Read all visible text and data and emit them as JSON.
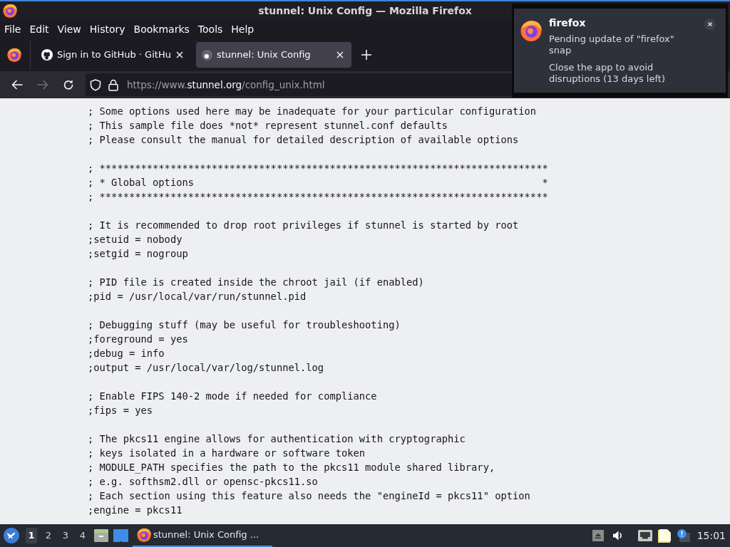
{
  "window": {
    "title": "stunnel: Unix Config — Mozilla Firefox"
  },
  "menu": [
    "File",
    "Edit",
    "View",
    "History",
    "Bookmarks",
    "Tools",
    "Help"
  ],
  "tabs": [
    {
      "title": "Sign in to GitHub · GitHu",
      "selected": false
    },
    {
      "title": "stunnel: Unix Config",
      "selected": true
    }
  ],
  "toolbar": {
    "forward_disabled": true,
    "url": {
      "prefix": "https://www.",
      "domain": "stunnel.org",
      "path": "/config_unix.html"
    }
  },
  "page": {
    "blocks": [
      [
        "; Some options used here may be inadequate for your particular configuration",
        "; This sample file does *not* represent stunnel.conf defaults",
        "; Please consult the manual for detailed description of available options"
      ],
      [
        "; ****************************************************************************",
        "; * Global options                                                           *",
        "; ****************************************************************************"
      ],
      [
        "; It is recommended to drop root privileges if stunnel is started by root",
        ";setuid = nobody",
        ";setgid = nogroup"
      ],
      [
        "; PID file is created inside the chroot jail (if enabled)",
        ";pid = /usr/local/var/run/stunnel.pid"
      ],
      [
        "; Debugging stuff (may be useful for troubleshooting)",
        ";foreground = yes",
        ";debug = info",
        ";output = /usr/local/var/log/stunnel.log"
      ],
      [
        "; Enable FIPS 140-2 mode if needed for compliance",
        ";fips = yes"
      ],
      [
        "; The pkcs11 engine allows for authentication with cryptographic",
        "; keys isolated in a hardware or software token",
        "; MODULE_PATH specifies the path to the pkcs11 module shared library,",
        "; e.g. softhsm2.dll or opensc-pkcs11.so",
        "; Each section using this feature also needs the \"engineId = pkcs11\" option",
        ";engine = pkcs11"
      ]
    ]
  },
  "notification": {
    "app": "firefox",
    "summary": "Pending update of \"firefox\" snap",
    "body": "Close the app to avoid disruptions (13 days left)"
  },
  "taskbar": {
    "workspaces": [
      {
        "label": "1",
        "selected": true
      },
      {
        "label": "2",
        "selected": false
      },
      {
        "label": "3",
        "selected": false
      },
      {
        "label": "4",
        "selected": false
      }
    ],
    "tasks": [
      {
        "label": "stunnel: Unix Config ...",
        "selected": true
      }
    ],
    "clock": "15:01"
  }
}
